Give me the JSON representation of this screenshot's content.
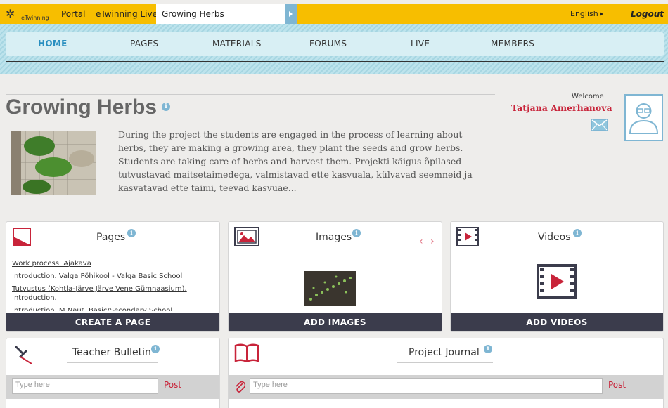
{
  "topbar": {
    "logo_text": "eTwinning",
    "portal": "Portal",
    "live": "eTwinning Live",
    "current": "Growing Herbs",
    "language": "English",
    "logout": "Logout"
  },
  "nav": {
    "items": [
      "HOME",
      "PAGES",
      "MATERIALS",
      "FORUMS",
      "LIVE",
      "MEMBERS"
    ]
  },
  "header": {
    "title": "Growing Herbs",
    "description": "During the project the students are engaged in the process of learning about herbs, they are making a growing area, they plant the seeds and grow herbs. Students are taking care of herbs and harvest them. Projekti käigus õpilased tutvustavad maitsetaimedega, valmistavad ette kasvuala, külvavad seemneid ja kasvatavad ette taimi, teevad kasvuae...",
    "welcome": "Welcome",
    "user": "Tatjana Amerhanova"
  },
  "cards": {
    "pages": {
      "title": "Pages",
      "links": [
        "Work process. Ajakava",
        "Introduction. Valga Põhikool - Valga Basic School",
        "Tutvustus (Kohtla-Järve Järve Vene Gümnaasium). Introduction.",
        "Introduction. M.Naut. Basic/Secondary School"
      ],
      "button": "CREATE A PAGE"
    },
    "images": {
      "title": "Images",
      "button": "ADD IMAGES"
    },
    "videos": {
      "title": "Videos",
      "button": "ADD VIDEOS"
    },
    "bulletin": {
      "title": "Teacher Bulletin",
      "placeholder": "Type here",
      "post": "Post"
    },
    "journal": {
      "title": "Project Journal",
      "placeholder": "Type here",
      "post": "Post"
    }
  },
  "colors": {
    "topbar": "#f7be00",
    "nav_accent": "#2a8fc0",
    "brand_red": "#c8243a",
    "footer": "#3b3c4c"
  }
}
